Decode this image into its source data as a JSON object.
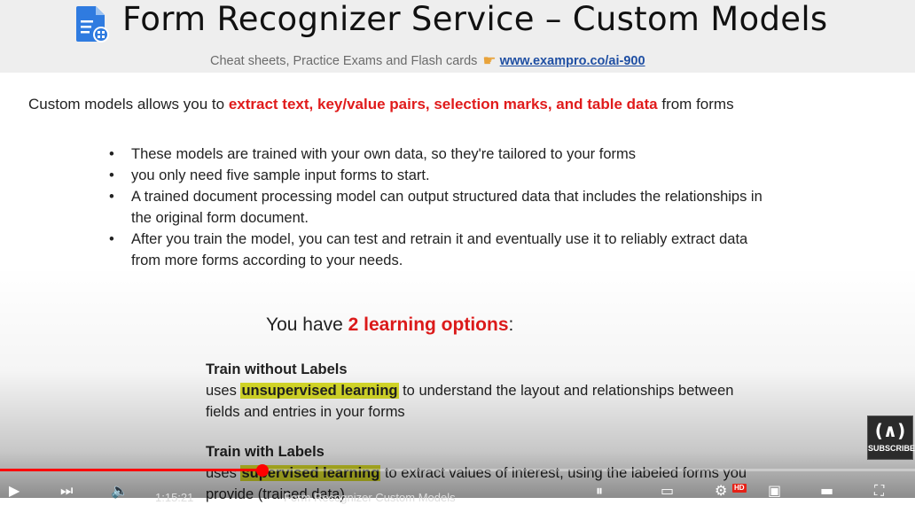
{
  "slide": {
    "title": "Form Recognizer Service – Custom Models",
    "subtitle_text": "Cheat sheets, Practice Exams and Flash cards",
    "subtitle_icon": "pointing-hand-icon",
    "subtitle_url": "www.exampro.co/ai-900",
    "intro_prefix": "Custom models allows you to",
    "intro_highlight": "extract text, key/value pairs, selection marks, and table data",
    "intro_suffix": "from forms",
    "bullets": [
      "These models are trained with your own data, so they're tailored to your forms",
      "you only need five sample input forms to start.",
      "A trained document processing model can output structured data that includes the relationships in the original form document.",
      "After you train the model, you can test and retrain it and eventually use it to reliably extract data from more forms according to your needs."
    ],
    "options_prefix": "You have",
    "options_highlight": "2 learning options",
    "options_suffix": ":",
    "option1": {
      "heading": "Train without Labels",
      "prefix": "uses",
      "highlight": "unsupervised learning",
      "rest": "to understand the layout and relationships between fields and entries in your forms"
    },
    "option2": {
      "heading": "Train with Labels",
      "prefix": "uses",
      "highlight": "supervised learning",
      "rest": "to extract values of interest, using the labeled forms you provide (trained data)"
    }
  },
  "player": {
    "time": "1:15:21",
    "chapter": "Form Recognizer Custom Models",
    "progress": 0.287,
    "hd_badge": "HD",
    "subscribe_label": "SUBSCRIBE",
    "subscribe_logo": "(∧)",
    "colors": {
      "accent": "#ff0000",
      "highlight": "#dfe32a",
      "red_text": "#e01b1b",
      "link": "#1f4fa3"
    }
  }
}
